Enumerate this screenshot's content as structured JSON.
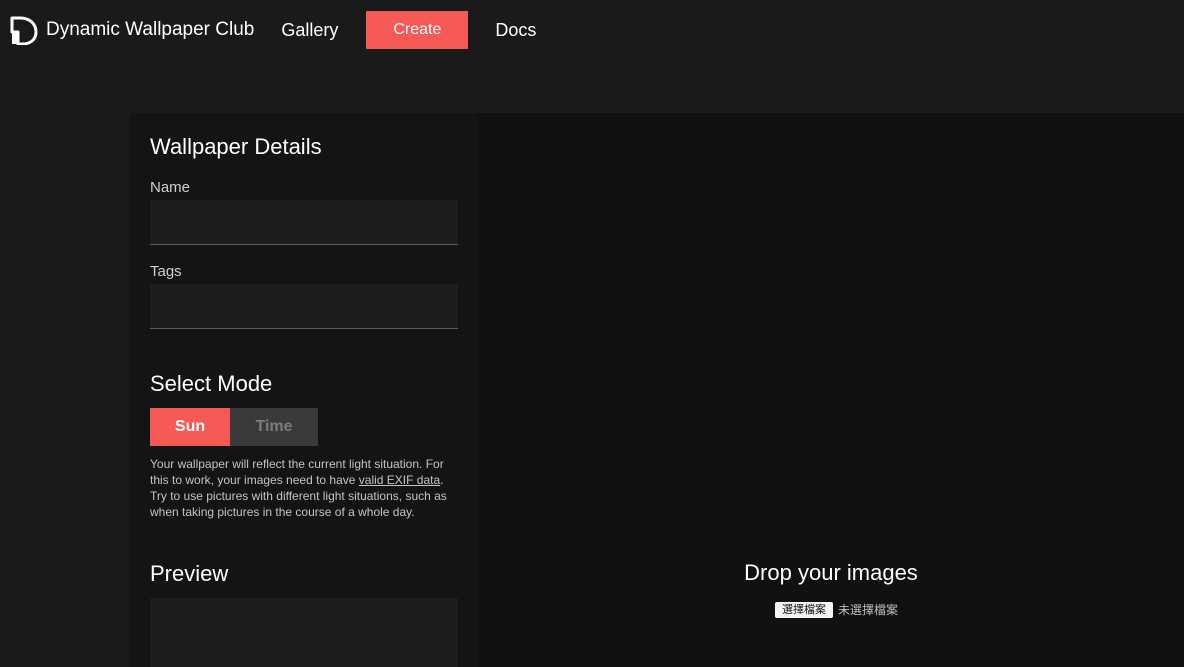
{
  "header": {
    "brand_name": "Dynamic Wallpaper Club",
    "nav": {
      "gallery": "Gallery",
      "create": "Create",
      "docs": "Docs"
    }
  },
  "details_panel": {
    "title": "Wallpaper Details",
    "name_label": "Name",
    "name_value": "",
    "tags_label": "Tags",
    "tags_value": "",
    "mode_title": "Select Mode",
    "modes": {
      "sun": "Sun",
      "time": "Time"
    },
    "selected_mode": "Sun",
    "mode_description_before": "Your wallpaper will reflect the current light situation. For this to work, your images need to have ",
    "mode_description_link": "valid EXIF data",
    "mode_description_after": ". Try to use pictures with different light situations, such as when taking pictures in the course of a whole day.",
    "preview_title": "Preview"
  },
  "dropzone": {
    "title": "Drop your images",
    "file_button": "選擇檔案",
    "file_status": "未選擇檔案"
  },
  "colors": {
    "accent": "#f65a57",
    "background": "#1b1a1b",
    "panel": "#151414"
  }
}
